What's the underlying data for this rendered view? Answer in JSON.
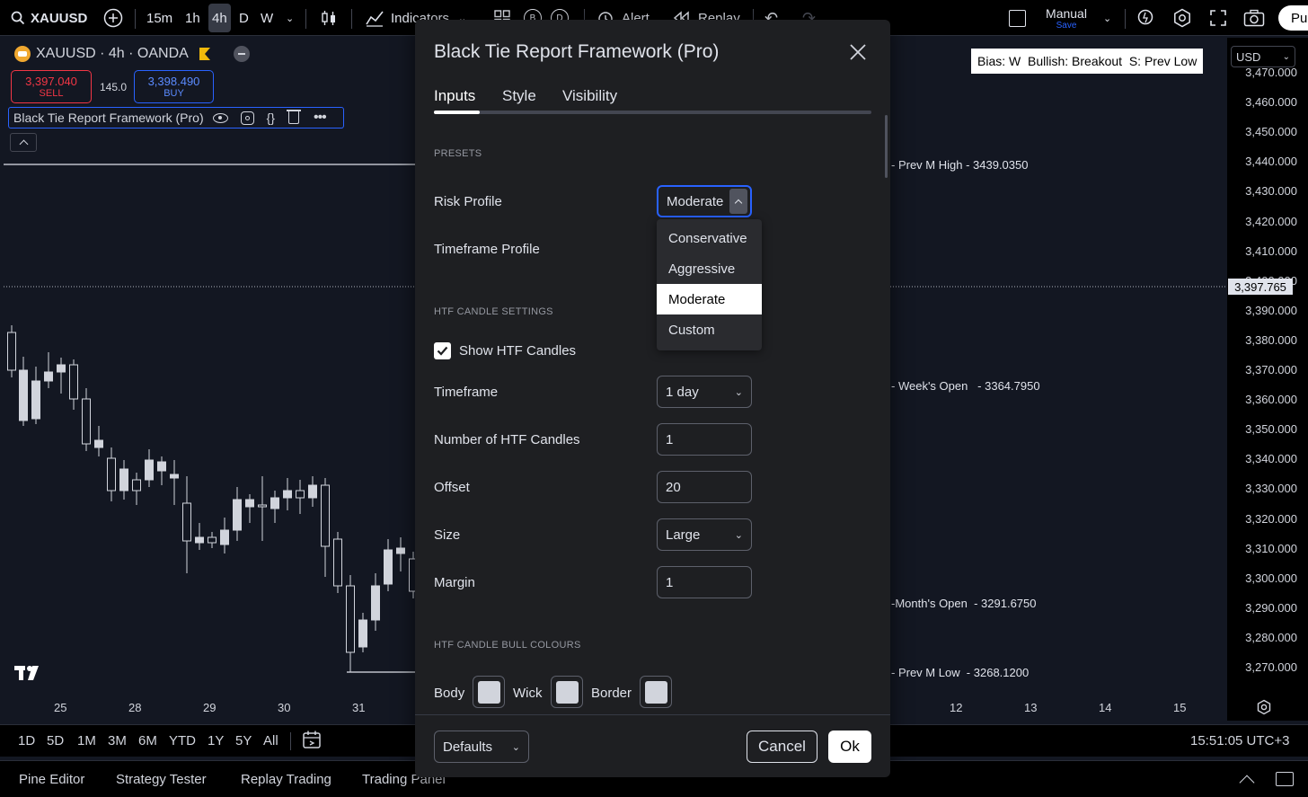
{
  "toolbar": {
    "symbol": "XAUUSD",
    "intervals": [
      "15m",
      "1h",
      "4h",
      "D",
      "W"
    ],
    "active_interval": "4h",
    "indicators_label": "Indicators",
    "alert_label": "Alert",
    "replay_label": "Replay",
    "b_label": "B",
    "d_label": "D",
    "manual_label": "Manual",
    "save_label": "Save",
    "publish_label": "Pub"
  },
  "legend": {
    "title": "XAUUSD · 4h · OANDA",
    "sell_price": "3,397.040",
    "sell_label": "SELL",
    "spread": "145.0",
    "buy_price": "3,398.490",
    "buy_label": "BUY",
    "indicator_name": "Black Tie Report Framework (Pro)"
  },
  "bias_box": "Bias: W  Bullish: Breakout  S: Prev Low",
  "currency": "USD",
  "price_axis": {
    "ticks": [
      "3,470.000",
      "3,460.000",
      "3,450.000",
      "3,440.000",
      "3,430.000",
      "3,420.000",
      "3,410.000",
      "3,400.000",
      "3,390.000",
      "3,380.000",
      "3,370.000",
      "3,360.000",
      "3,350.000",
      "3,340.000",
      "3,330.000",
      "3,320.000",
      "3,310.000",
      "3,300.000",
      "3,290.000",
      "3,280.000",
      "3,270.000"
    ],
    "current_price": "3,397.765"
  },
  "levels": {
    "prev_m_high": "Prev M High - 3439.0350",
    "week_open": "Week's Open   - 3364.7950",
    "month_open": "Month's Open  - 3291.6750",
    "prev_m_low": "Prev M Low  - 3268.1200"
  },
  "time_axis": {
    "left": [
      "25",
      "28",
      "29",
      "30",
      "31"
    ],
    "right": [
      "12",
      "13",
      "14",
      "15"
    ]
  },
  "range_bar": {
    "ranges": [
      "1D",
      "5D",
      "1M",
      "3M",
      "6M",
      "YTD",
      "1Y",
      "5Y",
      "All"
    ],
    "clock": "15:51:05 UTC+3"
  },
  "panel_bar": {
    "tabs": [
      "Pine Editor",
      "Strategy Tester",
      "Replay Trading",
      "Trading Panel"
    ]
  },
  "dialog": {
    "title": "Black Tie Report Framework (Pro)",
    "tabs": [
      "Inputs",
      "Style",
      "Visibility"
    ],
    "active_tab": "Inputs",
    "presets_section": "PRESETS",
    "risk_profile_label": "Risk Profile",
    "risk_profile_value": "Moderate",
    "timeframe_profile_label": "Timeframe Profile",
    "risk_options": [
      "Conservative",
      "Aggressive",
      "Moderate",
      "Custom"
    ],
    "selected_option": "Moderate",
    "htf_section": "HTF CANDLE SETTINGS",
    "show_htf_label": "Show HTF Candles",
    "show_htf_checked": true,
    "timeframe_label": "Timeframe",
    "timeframe_value": "1 day",
    "num_candles_label": "Number of HTF Candles",
    "num_candles_value": "1",
    "offset_label": "Offset",
    "offset_value": "20",
    "size_label": "Size",
    "size_value": "Large",
    "margin_label": "Margin",
    "margin_value": "1",
    "bull_section": "HTF CANDLE BULL COLOURS",
    "body_label": "Body",
    "wick_label": "Wick",
    "border_label": "Border",
    "defaults_label": "Defaults",
    "cancel_label": "Cancel",
    "ok_label": "Ok"
  },
  "colors": {
    "accent": "#2962ff",
    "sell": "#f23645",
    "buy": "#2962ff",
    "swatch": "#d1d4dc"
  }
}
